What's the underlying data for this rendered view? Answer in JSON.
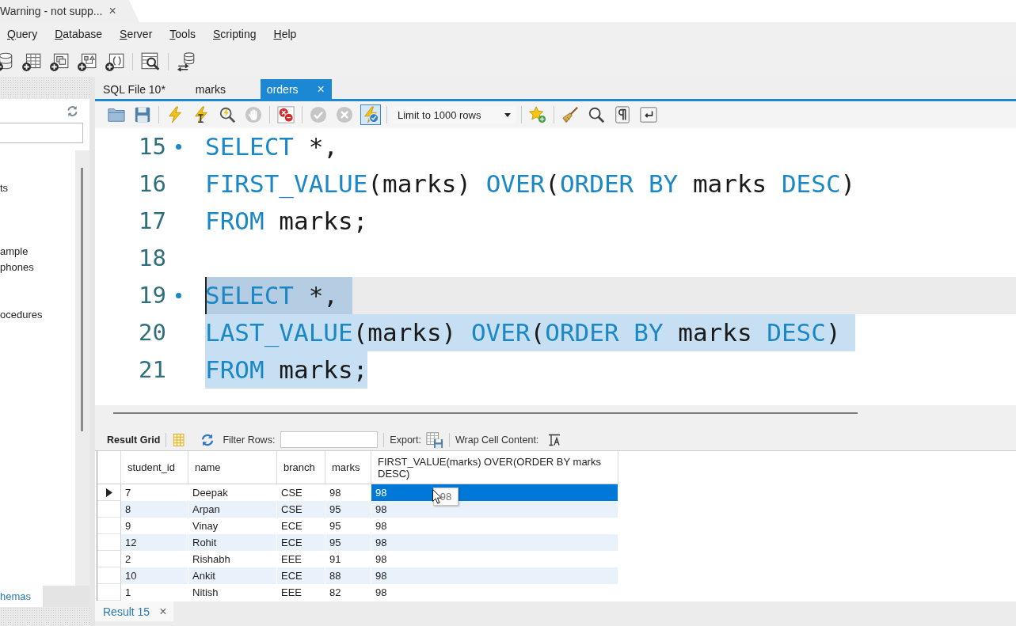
{
  "window_tab": {
    "title": "Warning - not supp...",
    "close": "×"
  },
  "menu": [
    "Query",
    "Database",
    "Server",
    "Tools",
    "Scripting",
    "Help"
  ],
  "main_toolbar": [
    [
      {
        "kind": "database-plus"
      },
      {
        "kind": "table-plus"
      },
      {
        "kind": "view-plus"
      },
      {
        "kind": "procedure-plus"
      },
      {
        "kind": "function-plus"
      }
    ],
    [
      {
        "kind": "inspector"
      }
    ],
    [
      {
        "kind": "reconnect"
      }
    ]
  ],
  "navigator": {
    "tree": [
      {
        "label": "ts"
      },
      {
        "label": "ample"
      },
      {
        "label": "phones"
      },
      {
        "label": "ocedures"
      }
    ],
    "tabs": [
      {
        "label": "hemas",
        "selected": true
      }
    ]
  },
  "editor_tabs": [
    {
      "label": "SQL File 10*",
      "selected": false
    },
    {
      "label": "marks",
      "selected": false
    },
    {
      "label": "orders",
      "selected": true,
      "close": "×"
    }
  ],
  "editor_toolbar": [
    [
      {
        "kind": "open-file",
        "disabled": false
      },
      {
        "kind": "save",
        "disabled": false
      }
    ],
    [
      {
        "kind": "execute",
        "disabled": false
      },
      {
        "kind": "execute-current",
        "disabled": false
      },
      {
        "kind": "explain",
        "disabled": false
      },
      {
        "kind": "stop",
        "disabled": true
      }
    ],
    [
      {
        "kind": "stop-on-error",
        "disabled": false
      }
    ],
    [
      {
        "kind": "commit",
        "disabled": true
      },
      {
        "kind": "rollback",
        "disabled": true
      },
      {
        "kind": "autocommit",
        "disabled": false,
        "pressed": true
      }
    ],
    [
      {
        "kind": "row-limit",
        "label": "Limit to 1000 rows"
      }
    ],
    [
      {
        "kind": "add-snippet",
        "disabled": false
      }
    ],
    [
      {
        "kind": "beautify",
        "disabled": false
      },
      {
        "kind": "find",
        "disabled": false
      },
      {
        "kind": "invisibles",
        "disabled": false
      },
      {
        "kind": "word-wrap",
        "disabled": false
      }
    ]
  ],
  "editor": {
    "lines": [
      {
        "number": "15",
        "marker": true,
        "selected": false,
        "current": false,
        "caret": false,
        "tokens": [
          {
            "kind": "keyword",
            "text": "SELECT"
          },
          {
            "kind": "plain",
            "text": " *,"
          }
        ]
      },
      {
        "number": "16",
        "marker": false,
        "selected": false,
        "current": false,
        "caret": false,
        "tokens": [
          {
            "kind": "keyword",
            "text": "FIRST_VALUE"
          },
          {
            "kind": "plain",
            "text": "(marks) "
          },
          {
            "kind": "keyword",
            "text": "OVER"
          },
          {
            "kind": "plain",
            "text": "("
          },
          {
            "kind": "keyword",
            "text": "ORDER BY"
          },
          {
            "kind": "plain",
            "text": " marks "
          },
          {
            "kind": "keyword",
            "text": "DESC"
          },
          {
            "kind": "plain",
            "text": ")"
          }
        ]
      },
      {
        "number": "17",
        "marker": false,
        "selected": false,
        "current": false,
        "caret": false,
        "tokens": [
          {
            "kind": "keyword",
            "text": "FROM"
          },
          {
            "kind": "plain",
            "text": " marks;"
          }
        ]
      },
      {
        "number": "18",
        "marker": false,
        "selected": false,
        "current": false,
        "caret": false
      },
      {
        "number": "19",
        "marker": true,
        "selected": true,
        "current": true,
        "caret": true,
        "tokens": [
          {
            "kind": "keyword",
            "text": "SELECT"
          },
          {
            "kind": "plain",
            "text": " *,"
          }
        ]
      },
      {
        "number": "20",
        "marker": false,
        "selected": true,
        "current": false,
        "caret": false,
        "tokens": [
          {
            "kind": "keyword",
            "text": "LAST_VALUE"
          },
          {
            "kind": "plain",
            "text": "(marks) "
          },
          {
            "kind": "keyword",
            "text": "OVER"
          },
          {
            "kind": "plain",
            "text": "("
          },
          {
            "kind": "keyword",
            "text": "ORDER BY"
          },
          {
            "kind": "plain",
            "text": " marks "
          },
          {
            "kind": "keyword",
            "text": "DESC"
          },
          {
            "kind": "plain",
            "text": ")"
          }
        ]
      },
      {
        "number": "21",
        "marker": false,
        "selected": true,
        "current": false,
        "caret": false,
        "tokens": [
          {
            "kind": "keyword",
            "text": "FROM"
          },
          {
            "kind": "plain",
            "text": " marks;"
          }
        ]
      }
    ]
  },
  "result_toolbar": {
    "view": "Result Grid",
    "filter_label": "Filter Rows:",
    "export_label": "Export:",
    "wrap_label": "Wrap Cell Content:"
  },
  "grid": {
    "columns": [
      "student_id",
      "name",
      "branch",
      "marks",
      "FIRST_VALUE(marks) OVER(ORDER BY marks DESC)"
    ],
    "rows": [
      {
        "current": true,
        "cells": [
          {
            "text": "7",
            "selected": false
          },
          {
            "text": "Deepak",
            "selected": false
          },
          {
            "text": "CSE",
            "selected": false
          },
          {
            "text": "98",
            "selected": false
          },
          {
            "text": "98",
            "selected": true
          }
        ]
      },
      {
        "current": false,
        "cells": [
          {
            "text": "8",
            "selected": false
          },
          {
            "text": "Arpan",
            "selected": false
          },
          {
            "text": "CSE",
            "selected": false
          },
          {
            "text": "95",
            "selected": false
          },
          {
            "text": "98",
            "selected": false
          }
        ]
      },
      {
        "current": false,
        "cells": [
          {
            "text": "9",
            "selected": false
          },
          {
            "text": "Vinay",
            "selected": false
          },
          {
            "text": "ECE",
            "selected": false
          },
          {
            "text": "95",
            "selected": false
          },
          {
            "text": "98",
            "selected": false
          }
        ]
      },
      {
        "current": false,
        "cells": [
          {
            "text": "12",
            "selected": false
          },
          {
            "text": "Rohit",
            "selected": false
          },
          {
            "text": "ECE",
            "selected": false
          },
          {
            "text": "95",
            "selected": false
          },
          {
            "text": "98",
            "selected": false
          }
        ]
      },
      {
        "current": false,
        "cells": [
          {
            "text": "2",
            "selected": false
          },
          {
            "text": "Rishabh",
            "selected": false
          },
          {
            "text": "EEE",
            "selected": false
          },
          {
            "text": "91",
            "selected": false
          },
          {
            "text": "98",
            "selected": false
          }
        ]
      },
      {
        "current": false,
        "cells": [
          {
            "text": "10",
            "selected": false
          },
          {
            "text": "Ankit",
            "selected": false
          },
          {
            "text": "ECE",
            "selected": false
          },
          {
            "text": "88",
            "selected": false
          },
          {
            "text": "98",
            "selected": false
          }
        ]
      },
      {
        "current": false,
        "cells": [
          {
            "text": "1",
            "selected": false
          },
          {
            "text": "Nitish",
            "selected": false
          },
          {
            "text": "EEE",
            "selected": false
          },
          {
            "text": "82",
            "selected": false
          },
          {
            "text": "98",
            "selected": false
          }
        ]
      }
    ],
    "tooltip": "98"
  },
  "result_tabs": [
    {
      "label": "Result 15",
      "selected": true,
      "close": "×"
    }
  ]
}
